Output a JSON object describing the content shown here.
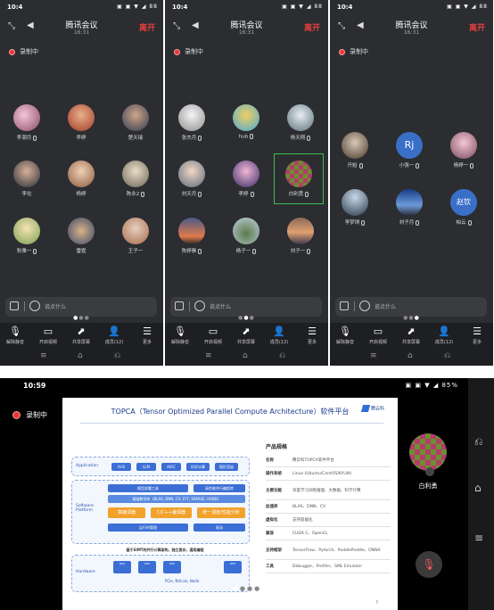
{
  "status": {
    "time": "10:4",
    "icons": "▣ ▣ ▼ ◢ 88"
  },
  "meeting": {
    "title": "腾讯会议",
    "timer": "16:31",
    "leave": "离开",
    "recording": "录制中"
  },
  "participants_p1": [
    "李潮月",
    "李婷",
    "楚天瑞",
    "李化",
    "杨婷",
    "陈永2",
    "秋雅一",
    "雷霆",
    "王子一"
  ],
  "participants_p2": [
    "张杰月",
    "hub",
    "杨天翔",
    "刘天月",
    "李婷",
    "白利勇",
    "陈婷雅",
    "杨子一",
    "刘子一"
  ],
  "participants_p3": [
    "开始",
    "小强一",
    "杨婷一",
    "李梦琪",
    "刘子月",
    "柏云"
  ],
  "avatar_text": {
    "rj": "Rj",
    "lj": "赵钦"
  },
  "chat": {
    "placeholder": "说点什么"
  },
  "toolbar": [
    "解除静音",
    "开启视频",
    "共享屏幕",
    "成员(12)",
    "更多"
  ],
  "nav": [
    "≡",
    "⌂",
    "⎌"
  ],
  "tablet": {
    "time": "10:59",
    "icons": "▣ ▣ ▼ ◢ 85%",
    "recording": "录制中",
    "slide_title": "TOPCA（Tensor Optimized Parallel Compute Architecture）软件平台",
    "logo_text": "腾云科",
    "app_label": "Application",
    "app_pills": [
      "AI·B",
      "LLM",
      "AIGC",
      "科学计算",
      "图形渲染"
    ],
    "sw_label": "Software Platform",
    "sw_top": [
      "模型部署工具",
      "高性能并行编程库"
    ],
    "sw_mid": "基础数学库（BLAS, DNN, CV, FFT, SPARSE, RAND）",
    "sw_orange": [
      "算编译器",
      "C/C++编译器",
      "统一调度/性能分析"
    ],
    "sw_bottom": [
      "运行时管理",
      "驱动"
    ],
    "hw_note": "基于SIMT的并行计算架构，独立显存，通用编程",
    "hw_label": "Hardware",
    "hw_boxes": [
      "GPU",
      "GPU",
      "GPU",
      "GPU"
    ],
    "hw_mid": "PCIe, NVLink, Node",
    "spec_heading": "产品规格",
    "spec_rows": [
      {
        "k": "名称",
        "v": "腾云科TOPCA软件平台"
      },
      {
        "k": "操作系统",
        "v": "Linux (Ubuntu/CentOS/KYLIN)"
      },
      {
        "k": "主要功能",
        "v": "深度学习训练推理、大数据、科学计算"
      },
      {
        "k": "加速库",
        "v": "BLAS、DNN、CV"
      },
      {
        "k": "虚拟化",
        "v": "支持容器化"
      },
      {
        "k": "兼容",
        "v": "CUDA C、OpenCL"
      },
      {
        "k": "支持框架",
        "v": "TensorFlow、Pytorch、PaddlePaddle、ONNX"
      },
      {
        "k": "工具",
        "v": "Debugger、Profiler、SML Emulator"
      }
    ],
    "page_num": "7",
    "self_name": "白利勇"
  }
}
